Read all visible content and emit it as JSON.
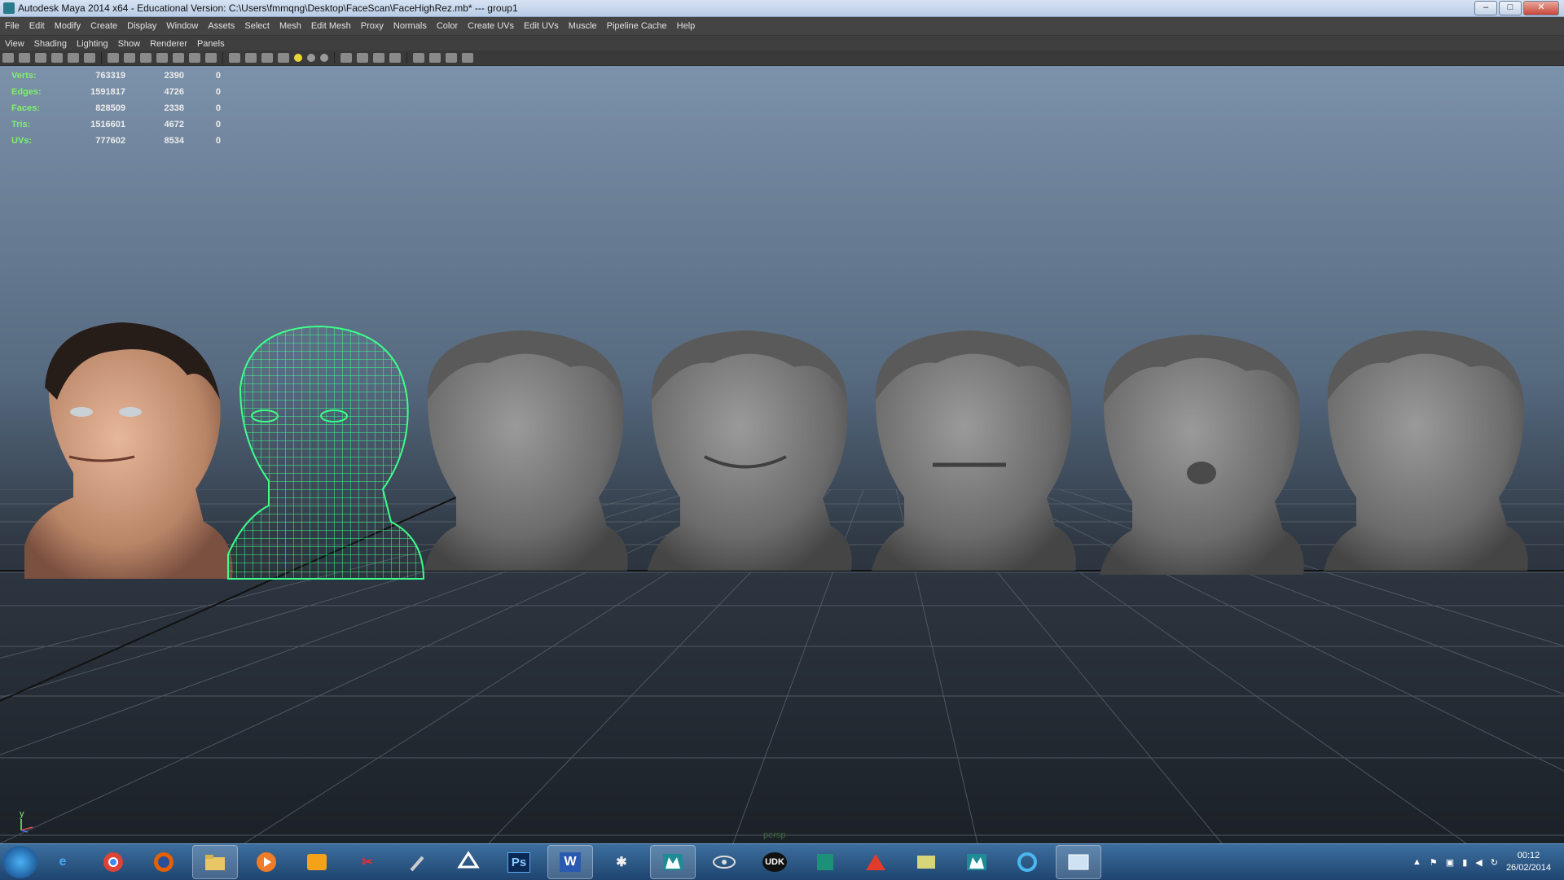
{
  "window": {
    "title": "Autodesk Maya 2014 x64 - Educational Version: C:\\Users\\fmmqng\\Desktop\\FaceScan\\FaceHighRez.mb*  ---  group1",
    "minimize": "–",
    "maximize": "□",
    "close": "✕"
  },
  "menubar": [
    "File",
    "Edit",
    "Modify",
    "Create",
    "Display",
    "Window",
    "Assets",
    "Select",
    "Mesh",
    "Edit Mesh",
    "Proxy",
    "Normals",
    "Color",
    "Create UVs",
    "Edit UVs",
    "Muscle",
    "Pipeline Cache",
    "Help"
  ],
  "panel_menu": [
    "View",
    "Shading",
    "Lighting",
    "Show",
    "Renderer",
    "Panels"
  ],
  "hud": [
    {
      "label": "Verts:",
      "total": "763319",
      "selected": "2390",
      "comp": "0"
    },
    {
      "label": "Edges:",
      "total": "1591817",
      "selected": "4726",
      "comp": "0"
    },
    {
      "label": "Faces:",
      "total": "828509",
      "selected": "2338",
      "comp": "0"
    },
    {
      "label": "Tris:",
      "total": "1516601",
      "selected": "4672",
      "comp": "0"
    },
    {
      "label": "UVs:",
      "total": "777602",
      "selected": "8534",
      "comp": "0"
    }
  ],
  "viewport": {
    "axis_label": "y",
    "camera_label": "persp",
    "model_count": 7
  },
  "taskbar": {
    "icons": [
      "ie-icon",
      "chrome-icon",
      "firefox-icon",
      "explorer-icon",
      "media-player-icon",
      "outlook-icon",
      "snipping-tool-icon",
      "microphone-icon",
      "unity-icon",
      "photoshop-icon",
      "word-icon",
      "zbrush-icon",
      "maya-icon",
      "eye-icon",
      "udk-icon",
      "maya-alt-icon",
      "3dsmax-icon",
      "folder-icon",
      "maya-2-icon",
      "cycle-icon",
      "window-icon"
    ],
    "ps_label": "Ps",
    "word_label": "W",
    "udk_label": "UDK",
    "time": "00:12",
    "date": "26/02/2014"
  },
  "colors": {
    "hud_label": "#7ff06e",
    "wireframe": "#3dff8a"
  }
}
